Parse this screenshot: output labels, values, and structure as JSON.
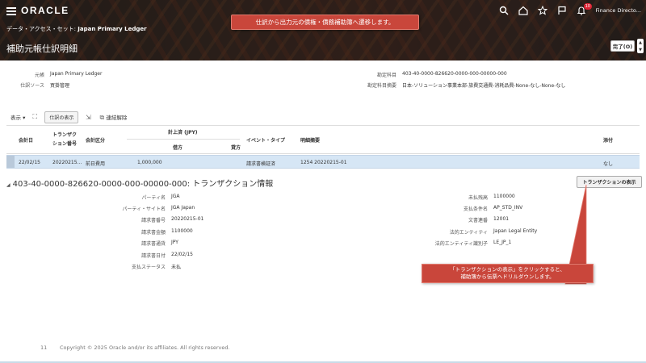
{
  "header": {
    "logo": "ORACLE",
    "dataset_label": "データ・アクセス・セット:",
    "dataset_value": "Japan Primary Ledger",
    "page_title": "補助元帳仕訳明細",
    "notification_count": "10",
    "user_name": "Finance Directo...",
    "done_button": "完了(O)"
  },
  "callouts": {
    "top": "仕訳から出力元の債権・債務補助簿へ遷移します。",
    "bottom_line1": "「トランザクションの表示」をクリックすると、",
    "bottom_line2": "補助簿から伝票へドリルダウンします。"
  },
  "details": {
    "ledger_label": "元帳",
    "ledger_value": "Japan Primary Ledger",
    "source_label": "仕訳ソース",
    "source_value": "買掛管理",
    "account_label": "勘定科目",
    "account_value": "403-40-0000-826620-0000-000-00000-000",
    "account_desc_label": "勘定科目摘要",
    "account_desc_value": "日本-ソリューション事業本部-旅費交通費-消耗品費-None-なし-None-なし"
  },
  "toolbar": {
    "view_label": "表示",
    "show_journal_button": "仕訳の表示",
    "unlink_button": "連結解除"
  },
  "table": {
    "headers": {
      "accounting_date": "会計日",
      "transaction_no_1": "トランザク",
      "transaction_no_2": "ション番号",
      "accounting_class": "会計区分",
      "recorded": "計上済 (JPY)",
      "debit": "借方",
      "credit": "貸方",
      "event_type": "イベント・タイプ",
      "line_desc": "明細摘要",
      "attachment": "添付"
    },
    "row": {
      "accounting_date": "22/02/15",
      "transaction_no": "20220215...",
      "accounting_class": "前日費用",
      "debit": "1,000,000",
      "credit": "",
      "event_type": "請求書検証済",
      "line_desc": "1254 20220215-01",
      "attachment": "なし"
    }
  },
  "transaction_info": {
    "title": "403-40-0000-826620-0000-000-00000-000: トランザクション情報",
    "show_transaction_button": "トランザクションの表示",
    "left": [
      {
        "label": "パーティ名",
        "value": "JGA"
      },
      {
        "label": "パーティ・サイト名",
        "value": "JGA Japan"
      },
      {
        "label": "請求書番号",
        "value": "20220215-01"
      },
      {
        "label": "請求書金額",
        "value": "1100000"
      },
      {
        "label": "請求書通貨",
        "value": "JPY"
      },
      {
        "label": "請求書日付",
        "value": "22/02/15"
      },
      {
        "label": "支払ステータス",
        "value": "未払"
      }
    ],
    "right": [
      {
        "label": "未払残高",
        "value": "1100000"
      },
      {
        "label": "支払条件名",
        "value": "AP_STD_INV"
      },
      {
        "label": "文書連番",
        "value": "12001"
      },
      {
        "label": "法的エンティティ",
        "value": "Japan Legal Entity"
      },
      {
        "label": "法的エンティティ識別子",
        "value": "LE_JP_1"
      }
    ]
  },
  "footer": {
    "page_number": "11",
    "copyright": "Copyright © 2025 Oracle and/or its affiliates. All rights reserved."
  },
  "colors": {
    "callout": "#c9463b",
    "selected_row": "#d6e6f5",
    "header_dark": "#2a2420"
  }
}
